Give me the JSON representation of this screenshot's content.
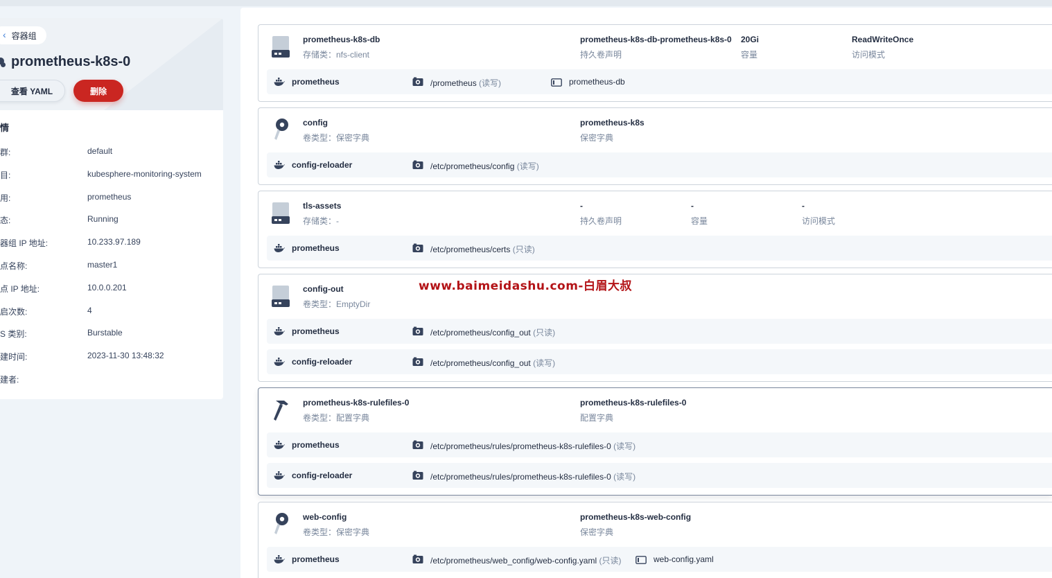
{
  "header": {
    "back_label": "容器组",
    "pod_name": "prometheus-k8s-0",
    "view_yaml_label": "查看 YAML",
    "delete_label": "删除"
  },
  "details": {
    "section_title": "情",
    "props": [
      {
        "key": "群:",
        "value": "default"
      },
      {
        "key": "目:",
        "value": "kubesphere-monitoring-system"
      },
      {
        "key": "用:",
        "value": "prometheus"
      },
      {
        "key": "态:",
        "value": "Running"
      },
      {
        "key": "器组 IP 地址:",
        "value": "10.233.97.189"
      },
      {
        "key": "点名称:",
        "value": "master1"
      },
      {
        "key": "点 IP 地址:",
        "value": "10.0.0.201"
      },
      {
        "key": "启次数:",
        "value": "4"
      },
      {
        "key": "S 类别:",
        "value": "Burstable"
      },
      {
        "key": "建时间:",
        "value": "2023-11-30 13:48:32"
      },
      {
        "key": "建者:",
        "value": ""
      }
    ]
  },
  "volumes": [
    {
      "icon": "storage-icon",
      "name": "prometheus-k8s-db",
      "type_text": "存储类：nfs-client",
      "cols": [
        {
          "title": "prometheus-k8s-db-prometheus-k8s-0",
          "sub": "持久卷声明"
        },
        {
          "title": "20Gi",
          "sub": "容量"
        },
        {
          "title": "ReadWriteOnce",
          "sub": "访问模式"
        }
      ],
      "mounts": [
        {
          "container": "prometheus",
          "path": "/prometheus",
          "mode": "(读写)",
          "extra": "prometheus-db"
        }
      ]
    },
    {
      "icon": "key-icon",
      "name": "config",
      "type_text": "卷类型：保密字典",
      "cols": [
        {
          "title": "prometheus-k8s",
          "sub": "保密字典"
        }
      ],
      "mounts": [
        {
          "container": "config-reloader",
          "path": "/etc/prometheus/config",
          "mode": "(读写)",
          "extra": ""
        }
      ]
    },
    {
      "icon": "storage-icon",
      "name": "tls-assets",
      "type_text": "存储类：-",
      "cols": [
        {
          "title": "-",
          "sub": "持久卷声明"
        },
        {
          "title": "-",
          "sub": "容量"
        },
        {
          "title": "-",
          "sub": "访问模式"
        }
      ],
      "mounts": [
        {
          "container": "prometheus",
          "path": "/etc/prometheus/certs",
          "mode": "(只读)",
          "extra": ""
        }
      ]
    },
    {
      "icon": "storage-icon",
      "name": "config-out",
      "type_text": "卷类型：EmptyDir",
      "cols": [],
      "mounts": [
        {
          "container": "prometheus",
          "path": "/etc/prometheus/config_out",
          "mode": "(只读)",
          "extra": ""
        },
        {
          "container": "config-reloader",
          "path": "/etc/prometheus/config_out",
          "mode": "(读写)",
          "extra": ""
        }
      ]
    },
    {
      "icon": "hammer-icon",
      "name": "prometheus-k8s-rulefiles-0",
      "type_text": "卷类型：配置字典",
      "cols": [
        {
          "title": "prometheus-k8s-rulefiles-0",
          "sub": "配置字典"
        }
      ],
      "mounts": [
        {
          "container": "prometheus",
          "path": "/etc/prometheus/rules/prometheus-k8s-rulefiles-0",
          "mode": "(读写)",
          "extra": ""
        },
        {
          "container": "config-reloader",
          "path": "/etc/prometheus/rules/prometheus-k8s-rulefiles-0",
          "mode": "(读写)",
          "extra": ""
        }
      ]
    },
    {
      "icon": "key-icon",
      "name": "web-config",
      "type_text": "卷类型：保密字典",
      "cols": [
        {
          "title": "prometheus-k8s-web-config",
          "sub": "保密字典"
        }
      ],
      "mounts": [
        {
          "container": "prometheus",
          "path": "/etc/prometheus/web_config/web-config.yaml",
          "mode": "(只读)",
          "extra": "web-config.yaml"
        }
      ]
    }
  ],
  "watermark": "www.baimeidashu.com-白眉大叔",
  "colors": {
    "primary_text": "#242e42",
    "secondary_text": "#79879c",
    "danger": "#ca2621",
    "watermark": "#b31317"
  }
}
